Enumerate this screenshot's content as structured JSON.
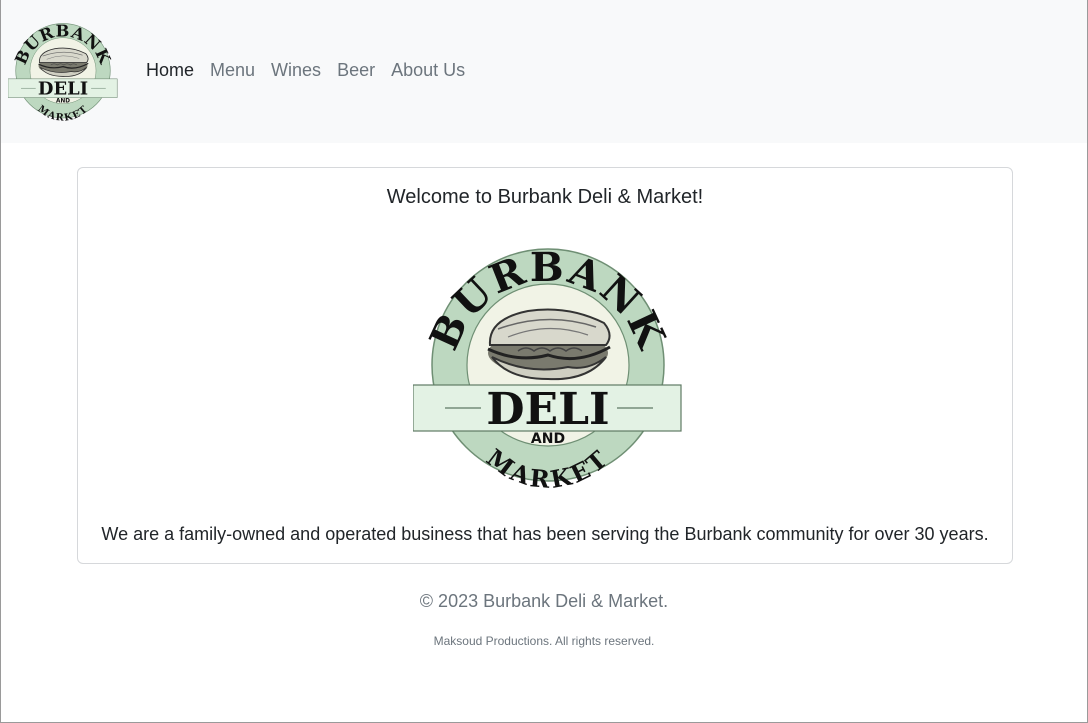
{
  "logo": {
    "word_top": "BURBANK",
    "word_center": "DELI",
    "word_and": "AND",
    "word_bottom": "MARKET",
    "colors": {
      "ring": "#bdd8c0",
      "band": "#e3f2e4",
      "inner": "#f1f3e6",
      "ink": "#111111"
    }
  },
  "nav": {
    "items": [
      {
        "label": "Home",
        "active": true
      },
      {
        "label": "Menu",
        "active": false
      },
      {
        "label": "Wines",
        "active": false
      },
      {
        "label": "Beer",
        "active": false
      },
      {
        "label": "About Us",
        "active": false
      }
    ]
  },
  "main": {
    "title": "Welcome to Burbank Deli & Market!",
    "description": "We are a family-owned and operated business that has been serving the Burbank community for over 30 years."
  },
  "footer": {
    "copyright": "© 2023 Burbank Deli & Market.",
    "credits": "Maksoud Productions. All rights reserved."
  }
}
